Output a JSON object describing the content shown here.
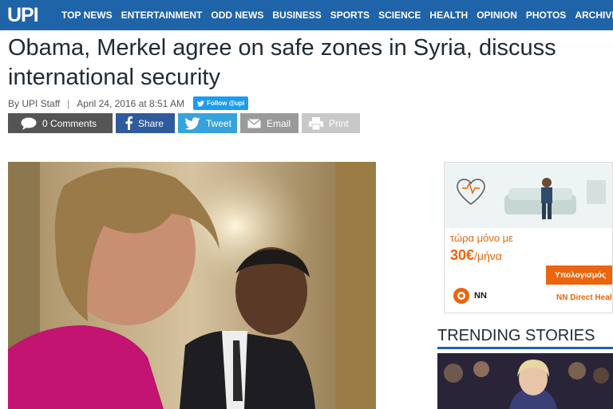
{
  "site": {
    "logo": "UPI"
  },
  "nav": {
    "items": [
      "TOP NEWS",
      "ENTERTAINMENT",
      "ODD NEWS",
      "BUSINESS",
      "SPORTS",
      "SCIENCE",
      "HEALTH",
      "OPINION",
      "PHOTOS",
      "ARCHIVE"
    ]
  },
  "article": {
    "title": "Obama, Merkel agree on safe zones in Syria, discuss international security",
    "author": "By UPI Staff",
    "separator": "|",
    "date": "April 24, 2016 at 8:51 AM",
    "follow_label": "Follow @upi"
  },
  "share": {
    "comments": "0 Comments",
    "share": "Share",
    "tweet": "Tweet",
    "email": "Email",
    "print": "Print"
  },
  "ad": {
    "text": "τώρα μόνο με",
    "price": "30€",
    "price_unit": "/μήνα",
    "button": "Υπολογισμός",
    "brand": "NN",
    "direct": "NN Direct Healt"
  },
  "sidebar": {
    "trending_title": "TRENDING STORIES"
  },
  "colors": {
    "nav": "#1f63a8",
    "accent": "#ea650d",
    "twitter": "#36a3dc",
    "facebook": "#2f5a9d"
  }
}
